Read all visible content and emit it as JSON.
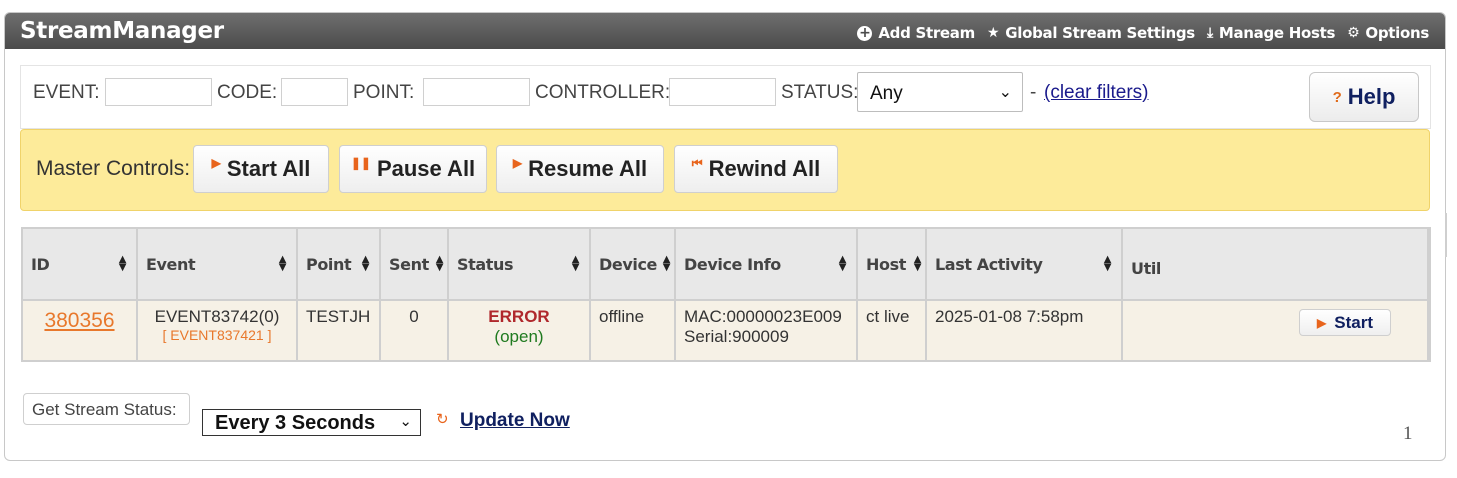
{
  "app": {
    "title": "StreamManager"
  },
  "nav": [
    {
      "label": "Add Stream",
      "icon": "plus-circle-icon"
    },
    {
      "label": "Global Stream Settings",
      "icon": "star-icon"
    },
    {
      "label": "Manage Hosts",
      "icon": "download-icon"
    },
    {
      "label": "Options",
      "icon": "gear-icon"
    }
  ],
  "filters": {
    "event_label": "EVENT:",
    "code_label": "CODE:",
    "point_label": "POINT:",
    "controller_label": "CONTROLLER:",
    "status_label": "STATUS:",
    "status_value": "Any",
    "dash": "-",
    "clear_link": "(clear filters)",
    "help_label": "Help",
    "help_icon": "?"
  },
  "master": {
    "label": "Master Controls:",
    "buttons": [
      {
        "label": "Start All",
        "icon": "play-icon"
      },
      {
        "label": "Pause All",
        "icon": "pause-icon"
      },
      {
        "label": "Resume All",
        "icon": "play-icon"
      },
      {
        "label": "Rewind All",
        "icon": "rewind-icon"
      }
    ]
  },
  "table": {
    "headers": [
      "ID",
      "Event",
      "Point",
      "Sent",
      "Status",
      "Device",
      "Device Info",
      "Host",
      "Last Activity",
      "Util"
    ],
    "rows": [
      {
        "id": "380356",
        "event": "EVENT83742(0)",
        "event_sub": "[ EVENT837421 ]",
        "point": "TESTJH",
        "sent": "0",
        "status": "ERROR",
        "status_sub": "(open)",
        "device": "offline",
        "device_info_mac": "MAC:00000023E009",
        "device_info_serial": "Serial:900009",
        "host": "ct live",
        "last_activity": "2025-01-08 7:58pm",
        "util_button": "Start"
      }
    ]
  },
  "footer": {
    "status_label": "Get Stream Status:",
    "interval": "Every 3 Seconds",
    "update_link": "Update Now",
    "page": "1"
  },
  "colors": {
    "accent": "#e8641c",
    "titlebar": "#4b4b4b",
    "master_bg": "#fdeb9a",
    "error": "#b0282c",
    "ok": "#1f7a1f"
  }
}
